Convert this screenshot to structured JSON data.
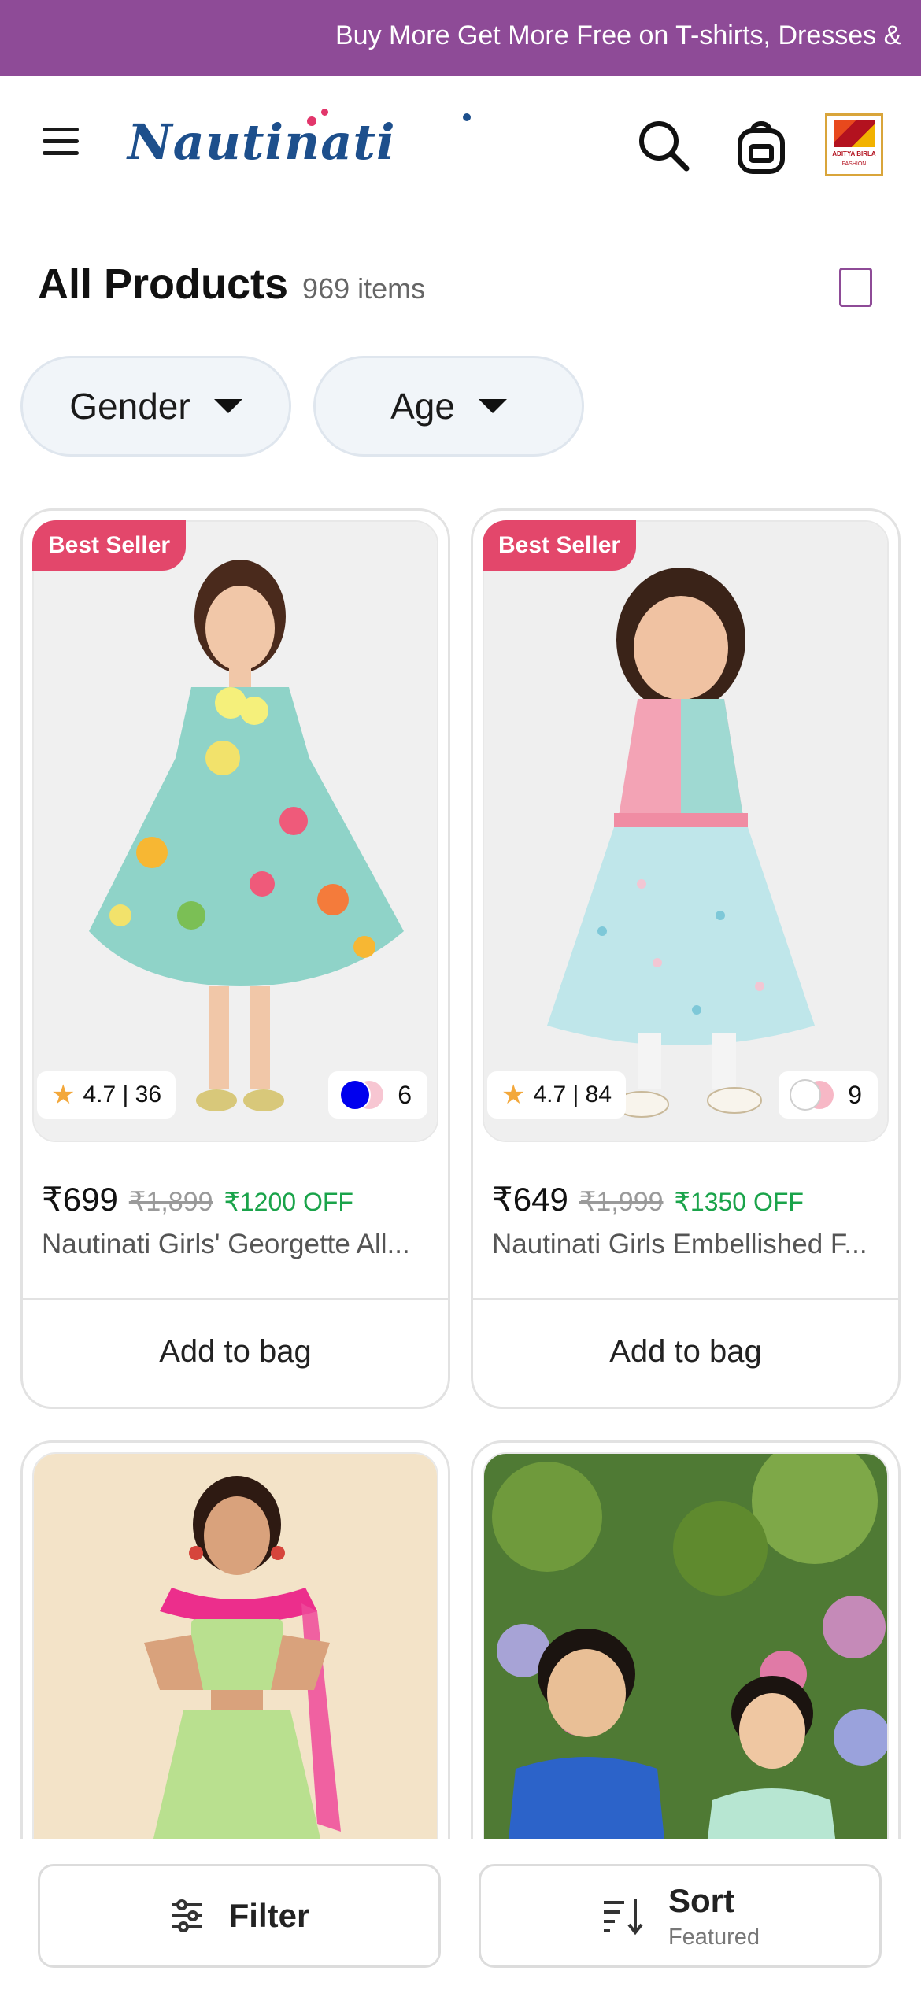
{
  "promo": {
    "text": "Buy More Get More Free on T-shirts, Dresses &"
  },
  "header": {
    "logo_text": "Nautinati",
    "brand_badge_line1": "ADITYA BIRLA",
    "brand_badge_line2": "FASHION",
    "icons": [
      "menu-icon",
      "search-icon",
      "bag-icon"
    ]
  },
  "listing": {
    "title": "All Products",
    "count": "969 items"
  },
  "filters": [
    {
      "label": "Gender"
    },
    {
      "label": "Age"
    }
  ],
  "products": [
    {
      "badge": "Best Seller",
      "rating": "4.7 | 36",
      "swatch_count": "6",
      "swatch_colors": [
        "#0000ee",
        "#f7c6d2"
      ],
      "price": "₹699",
      "mrp": "₹1,899",
      "discount": "₹1200 OFF",
      "name": "Nautinati Girls' Georgette All...",
      "cta": "Add to bag"
    },
    {
      "badge": "Best Seller",
      "rating": "4.7 | 84",
      "swatch_count": "9",
      "swatch_colors": [
        "#ffffff",
        "#f7b8c6"
      ],
      "price": "₹649",
      "mrp": "₹1,999",
      "discount": "₹1350 OFF",
      "name": "Nautinati Girls Embellished F...",
      "cta": "Add to bag"
    }
  ],
  "bottom_bar": {
    "filter_label": "Filter",
    "sort_label": "Sort",
    "sort_value": "Featured"
  },
  "colors": {
    "promo_bg": "#8e4b97",
    "best_seller": "#e3476b",
    "discount_green": "#1aa34a",
    "logo_blue": "#1d4f8c"
  }
}
